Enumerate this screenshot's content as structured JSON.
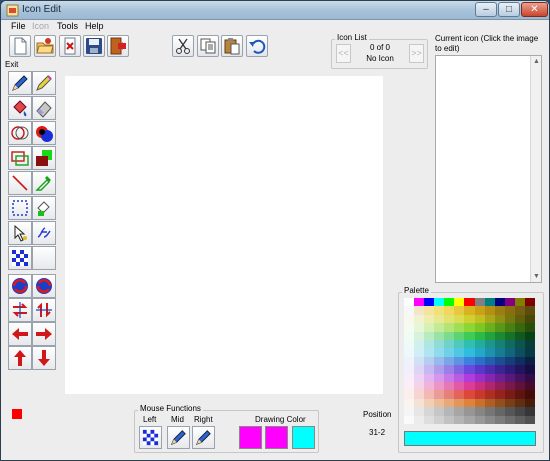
{
  "window": {
    "title": "Icon Edit"
  },
  "menu": [
    {
      "label": "File",
      "enabled": true
    },
    {
      "label": "Icon",
      "enabled": false
    },
    {
      "label": "Tools",
      "enabled": true
    },
    {
      "label": "Help",
      "enabled": true
    }
  ],
  "toolbar_exit_label": "Exit",
  "icon_list": {
    "title": "Icon List",
    "count": "0 of 0",
    "name": "No Icon",
    "prev_label": "<<",
    "next_label": ">>"
  },
  "current_icon": {
    "title": "Current icon (Click the image to edit)"
  },
  "palette": {
    "title": "Palette",
    "selected_color": "#00ffff",
    "colors": [
      [
        "#ffffff",
        "#ff00ff",
        "#0000ff",
        "#00ffff",
        "#00ff00",
        "#ffff00",
        "#ff0000",
        "#808080",
        "#008080",
        "#000080",
        "#800080",
        "#808000",
        "#800000"
      ],
      [
        "#f7f7f7",
        "#f2e6c8",
        "#f4e49c",
        "#f2e17a",
        "#efd85e",
        "#e6c940",
        "#d9b21f",
        "#c9a017",
        "#b48f13",
        "#9c7d12",
        "#8a6e10",
        "#766010",
        "#5e4c0e"
      ],
      [
        "#f8f8f0",
        "#f2f2d0",
        "#eeeeb0",
        "#e8e890",
        "#e2e270",
        "#dcdc50",
        "#d0d030",
        "#c0c020",
        "#a8a818",
        "#909014",
        "#787810",
        "#60600c",
        "#484808"
      ],
      [
        "#f4fbf0",
        "#e6f6d6",
        "#d6f0b6",
        "#c4ea96",
        "#b2e476",
        "#a0de56",
        "#8ed636",
        "#7cc626",
        "#6ab01e",
        "#589818",
        "#488012",
        "#38680e",
        "#28500a"
      ],
      [
        "#f0fbf2",
        "#d6f3da",
        "#b8ebc0",
        "#9ae3a6",
        "#7cdb8c",
        "#5ed372",
        "#40cb58",
        "#2cba46",
        "#24a23c",
        "#1c8a32",
        "#167228",
        "#105a20",
        "#0a4218"
      ],
      [
        "#eefaf8",
        "#d0f0ec",
        "#b0e6e0",
        "#90dcd4",
        "#70d2c8",
        "#50c8bc",
        "#30beb0",
        "#22ac9e",
        "#1c968a",
        "#168076",
        "#106a62",
        "#0c544e",
        "#083e3a"
      ],
      [
        "#eef8fb",
        "#cfeef6",
        "#afe4f1",
        "#8fdaec",
        "#6fd0e7",
        "#4fc6e2",
        "#2fbcdd",
        "#22a8c8",
        "#1c92ae",
        "#167c94",
        "#10667a",
        "#0c5060",
        "#083a46"
      ],
      [
        "#eef3fb",
        "#d2e0f6",
        "#b4cdf1",
        "#96baec",
        "#78a7e7",
        "#5a94e2",
        "#3c81dd",
        "#2c6ec8",
        "#245eae",
        "#1c4e94",
        "#163e7a",
        "#102e60",
        "#0a1e46"
      ],
      [
        "#f2effb",
        "#ddd4f6",
        "#c6b8f1",
        "#af9cec",
        "#9880e7",
        "#8164e2",
        "#6a48dd",
        "#5838c8",
        "#4a2eae",
        "#3c2494",
        "#2e1c7a",
        "#221460",
        "#160c46"
      ],
      [
        "#f8eefb",
        "#edd2f6",
        "#e1b4f1",
        "#d596ec",
        "#c978e7",
        "#bd5ae2",
        "#b13cdd",
        "#9c2ec8",
        "#8626ae",
        "#701e94",
        "#5a187a",
        "#461260",
        "#320c46"
      ],
      [
        "#fbeef6",
        "#f6d2e6",
        "#f1b4d6",
        "#ec96c6",
        "#e778b6",
        "#e25aa6",
        "#dd3c96",
        "#c82e82",
        "#ae266e",
        "#941e5c",
        "#7a184a",
        "#60123a",
        "#460c2a"
      ],
      [
        "#fbefee",
        "#f6d4d2",
        "#f1b8b4",
        "#ec9c96",
        "#e78078",
        "#e2645a",
        "#dd483c",
        "#c8382c",
        "#ae2e24",
        "#94241c",
        "#7a1c16",
        "#601410",
        "#460c0a"
      ],
      [
        "#fbf4ee",
        "#f6e2d2",
        "#f1cfb4",
        "#ecbc96",
        "#e7a978",
        "#e2965a",
        "#dd833c",
        "#c8702c",
        "#ae5e24",
        "#944e1c",
        "#7a3e16",
        "#602e10",
        "#461e0a"
      ],
      [
        "#f5f5f5",
        "#e6e6e6",
        "#d6d6d6",
        "#c6c6c6",
        "#b6b6b6",
        "#a6a6a6",
        "#969696",
        "#868686",
        "#767676",
        "#666666",
        "#565656",
        "#464646",
        "#363636"
      ],
      [
        "#fafafa",
        "#ececec",
        "#dedede",
        "#d0d0d0",
        "#c2c2c2",
        "#b4b4b4",
        "#a6a6a6",
        "#989898",
        "#8a8a8a",
        "#7c7c7c",
        "#6e6e6e",
        "#606060",
        "#525252"
      ]
    ]
  },
  "mouse_functions": {
    "title": "Mouse Functions",
    "left_label": "Left",
    "mid_label": "Mid",
    "right_label": "Right",
    "drawing_color_label": "Drawing Color",
    "left_color": "#ff00ff",
    "mid_color": "#ff00ff",
    "right_color": "#00ffff"
  },
  "position": {
    "label": "Position",
    "value": "31-2"
  },
  "indicator_color": "#ff0000"
}
